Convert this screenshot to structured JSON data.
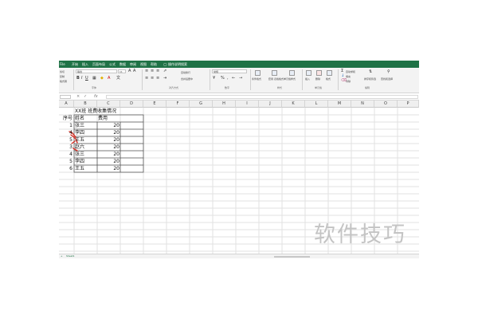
{
  "menu": {
    "file": "File",
    "items": [
      "开始",
      "插入",
      "页面布局",
      "公式",
      "数据",
      "审阅",
      "视图",
      "帮助"
    ],
    "tellme": "操作说明搜索"
  },
  "ribbon": {
    "clipboard": [
      "剪切",
      "复制",
      "格式刷"
    ],
    "font_name": "等线",
    "font_size": "11",
    "font_group": "字体",
    "align_group": "对齐方式",
    "wrap_text": "自动换行",
    "merge_center": "合并后居中",
    "number_format": "常规",
    "number_group": "数字",
    "cond_format": "条件格式",
    "table_format": "套用\n表格格式",
    "cell_styles": "单元格样式",
    "styles_group": "样式",
    "insert": "插入",
    "delete": "删除",
    "format": "格式",
    "cells_group": "单元格",
    "autosum": "自动求和",
    "fill": "填充",
    "clear": "清除",
    "sort_filter": "排序和筛选",
    "find_select": "查找和选择",
    "edit_group": "编辑"
  },
  "formula_bar": {
    "name_box": "",
    "fx": "fx",
    "value": ""
  },
  "columns": [
    "A",
    "B",
    "C",
    "D",
    "E",
    "F",
    "G",
    "H",
    "I",
    "J",
    "K",
    "L",
    "M",
    "N",
    "O",
    "P"
  ],
  "sheet": {
    "title": "XX班 班费收集情况",
    "header_a": "序号",
    "header_b": "姓名",
    "header_c": "费用",
    "rows": [
      {
        "a": "1",
        "b": "张三",
        "c": "20"
      },
      {
        "a": "4",
        "b": "李四",
        "c": "20"
      },
      {
        "a": "5",
        "b": "王五",
        "c": "20"
      },
      {
        "a": "3",
        "b": "赵六",
        "c": "20"
      },
      {
        "a": "4",
        "b": "张三",
        "c": "20"
      },
      {
        "a": "5",
        "b": "李四",
        "c": "20"
      },
      {
        "a": "6",
        "b": "王五",
        "c": "20"
      }
    ]
  },
  "status": {
    "sheet_tab": "Sheet1"
  },
  "watermark": "软件技巧",
  "colors": {
    "accent": "#1f7246",
    "annotation": "#d93025"
  }
}
